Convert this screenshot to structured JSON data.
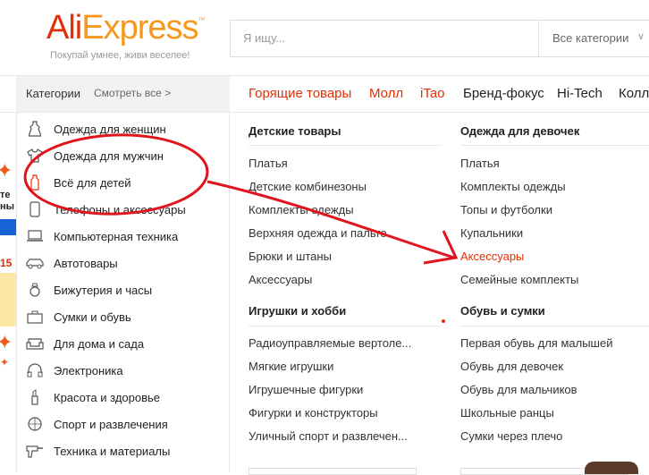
{
  "header": {
    "logo_part1": "Ali",
    "logo_part2": "Express",
    "logo_tm": "™",
    "tagline": "Покупай умнее, живи веселее!",
    "search_placeholder": "Я ищу...",
    "search_category": "Все категории"
  },
  "nav": {
    "categories_label": "Категории",
    "see_all": "Смотреть все >",
    "items": [
      "Горящие товары",
      "Молл",
      "iTao",
      "Бренд-фокус",
      "Hi-Tech",
      "Колл"
    ]
  },
  "left_strip": {
    "text_top": "те",
    "text_bottom": "ны",
    "number": "15"
  },
  "sidebar": {
    "items": [
      {
        "label": "Одежда для женщин",
        "icon": "dress-icon"
      },
      {
        "label": "Одежда для мужчин",
        "icon": "shirt-icon"
      },
      {
        "label": "Всё для детей",
        "icon": "baby-bottle-icon"
      },
      {
        "label": "Телефоны и аксессуары",
        "icon": "phone-icon"
      },
      {
        "label": "Компьютерная техника",
        "icon": "laptop-icon"
      },
      {
        "label": "Автотовары",
        "icon": "car-icon"
      },
      {
        "label": "Бижутерия и часы",
        "icon": "ring-icon"
      },
      {
        "label": "Сумки и обувь",
        "icon": "bag-icon"
      },
      {
        "label": "Для дома и сада",
        "icon": "sofa-icon"
      },
      {
        "label": "Электроника",
        "icon": "headphones-icon"
      },
      {
        "label": "Красота и здоровье",
        "icon": "cosmetics-icon"
      },
      {
        "label": "Спорт и развлечения",
        "icon": "ball-icon"
      },
      {
        "label": "Техника и материалы",
        "icon": "drill-icon"
      }
    ]
  },
  "columns": {
    "left": {
      "group1": {
        "title": "Детские товары",
        "links": [
          "Платья",
          "Детские комбинезоны",
          "Комплекты одежды",
          "Верхняя одежда и пальто",
          "Брюки и штаны",
          "Аксессуары"
        ]
      },
      "group2": {
        "title": "Игрушки и хобби",
        "links": [
          "Радиоуправляемые вертоле...",
          "Мягкие игрушки",
          "Игрушечные фигурки",
          "Фигурки и конструкторы",
          "Уличный спорт и развлечен..."
        ]
      }
    },
    "right": {
      "group1": {
        "title": "Одежда для девочек",
        "links": [
          "Платья",
          "Комплекты одежды",
          "Топы и футболки",
          "Купальники",
          "Аксессуары",
          "Семейные комплекты"
        ]
      },
      "group2": {
        "title": "Обувь и сумки",
        "links": [
          "Первая обувь для малышей",
          "Обувь для девочек",
          "Обувь для мальчиков",
          "Школьные ранцы",
          "Сумки через плечо"
        ]
      }
    }
  },
  "colors": {
    "accent": "#e62e04",
    "brand_orange": "#f7971d",
    "annotation": "#e0141c"
  }
}
